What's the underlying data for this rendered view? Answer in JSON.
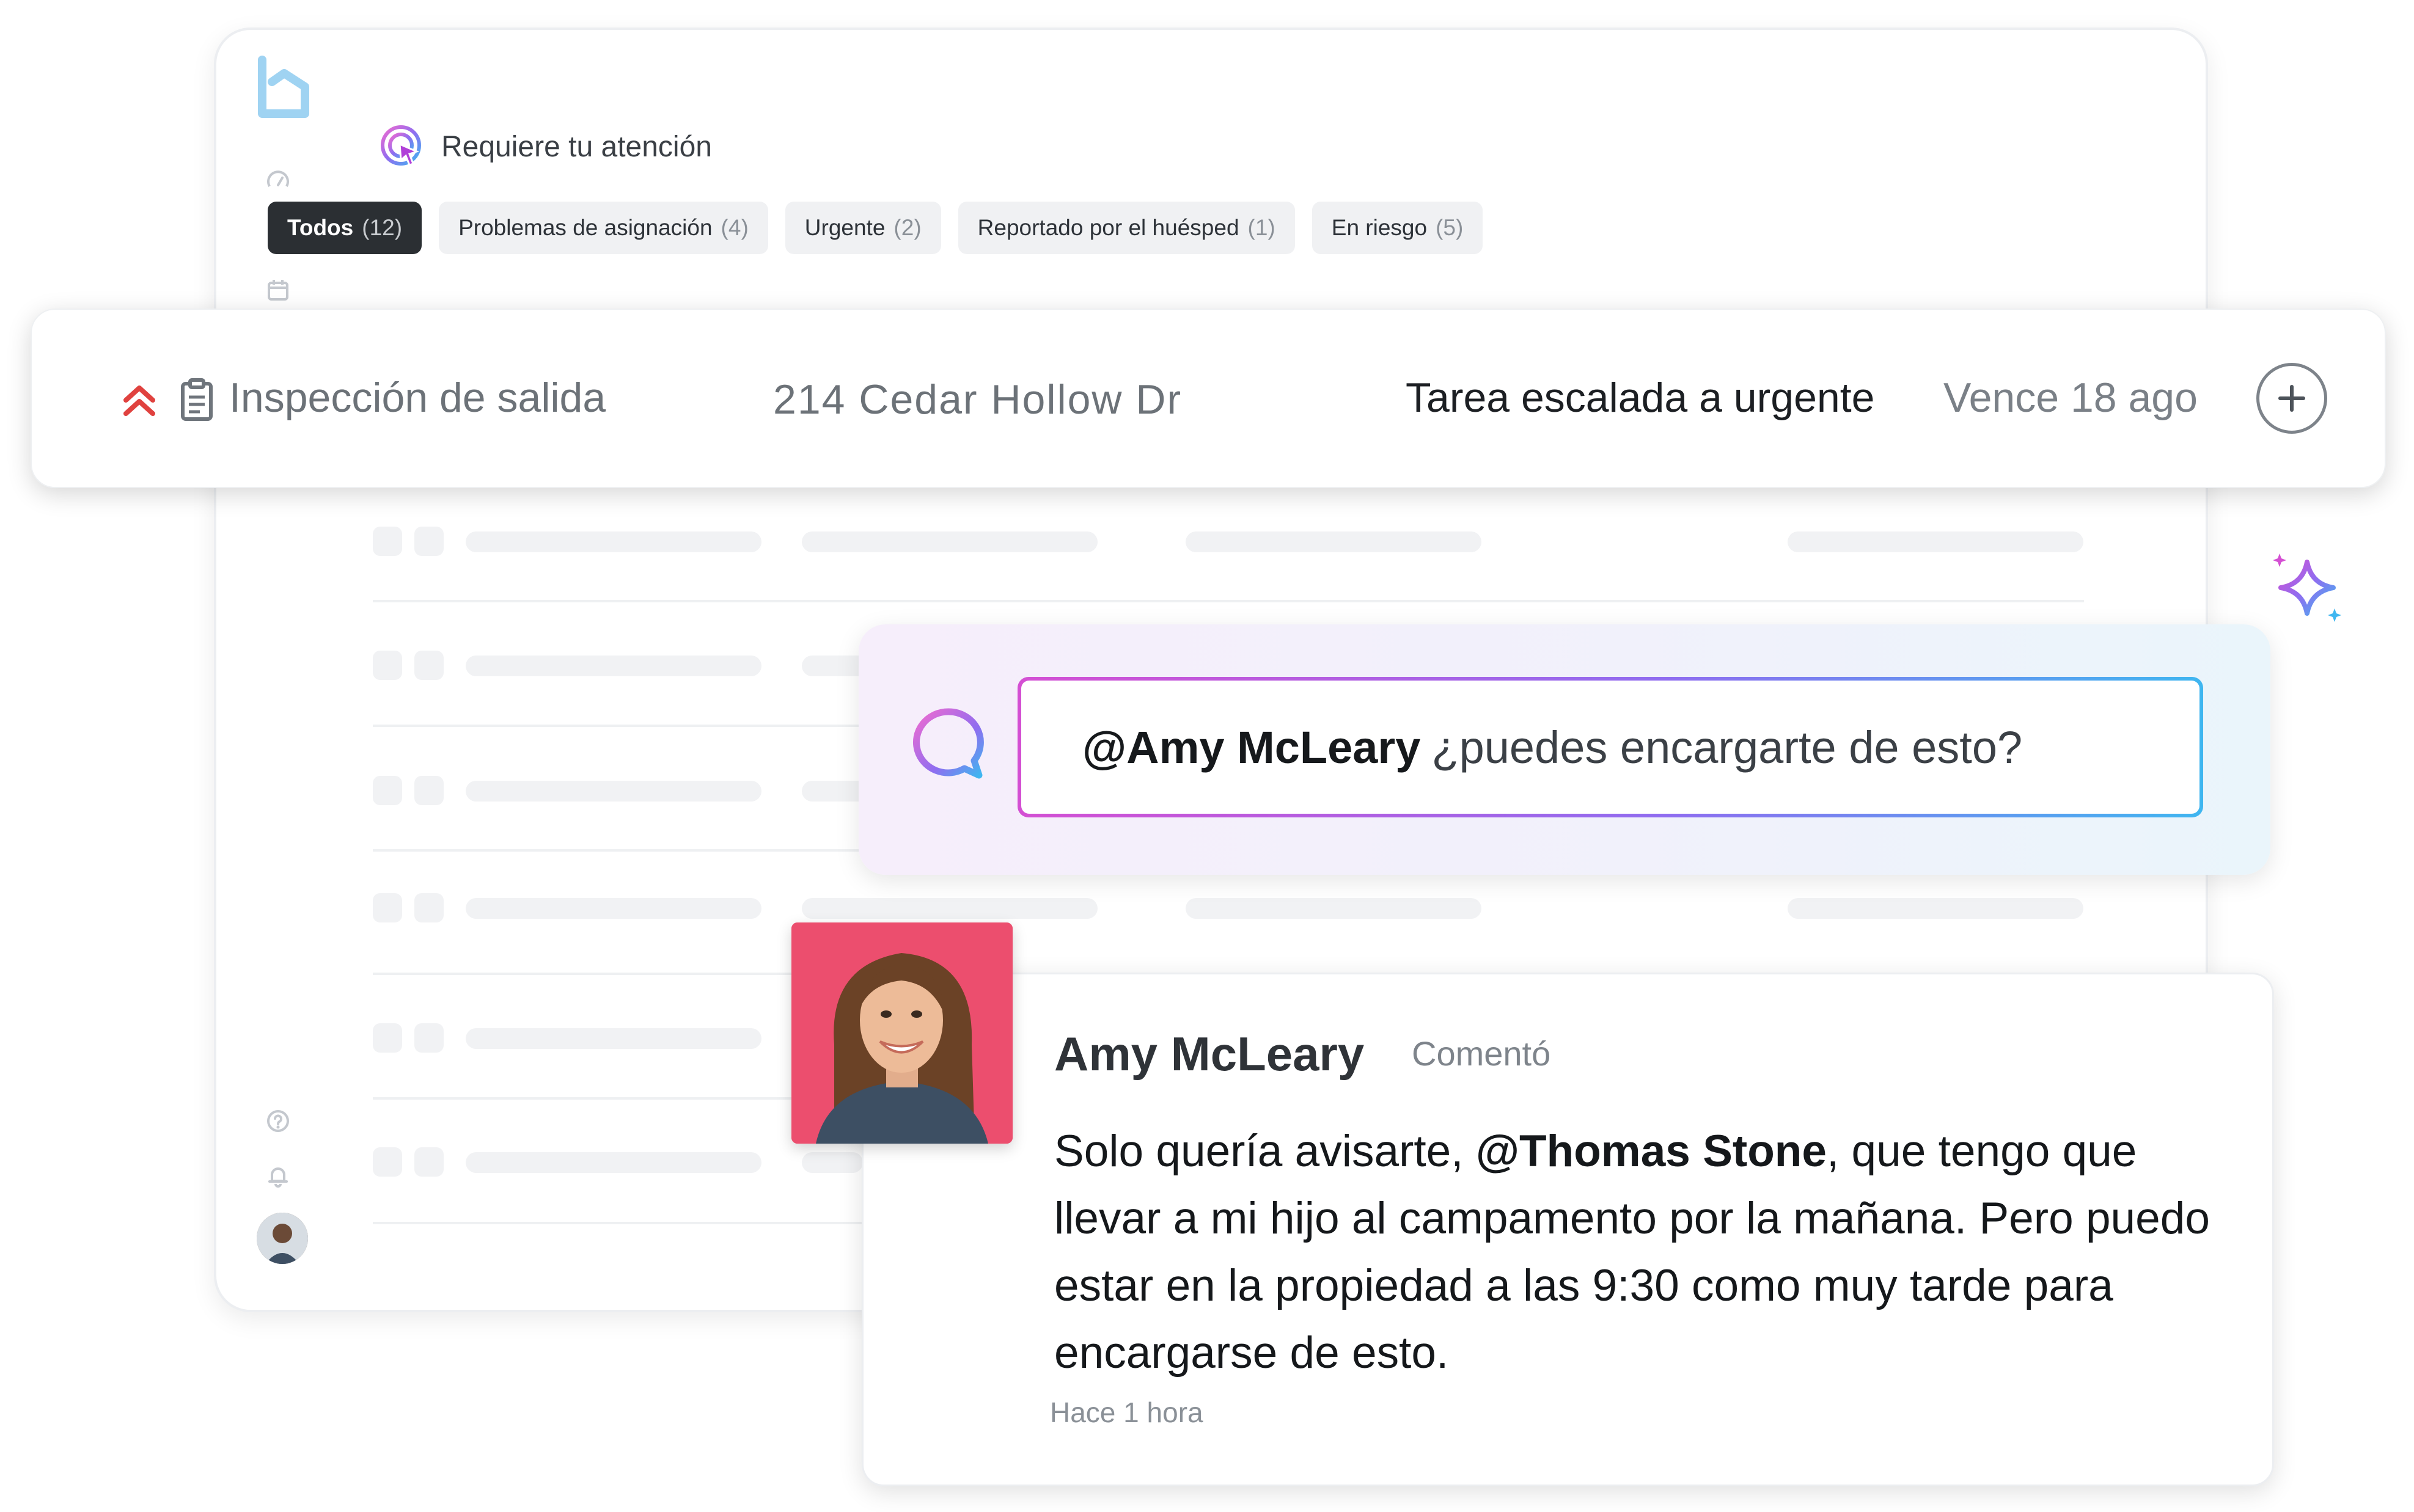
{
  "header": {
    "section_title": "Requiere tu atención"
  },
  "tabs": [
    {
      "label": "Todos",
      "count": "(12)",
      "active": true
    },
    {
      "label": "Problemas de asignación",
      "count": "(4)",
      "active": false
    },
    {
      "label": "Urgente",
      "count": "(2)",
      "active": false
    },
    {
      "label": "Reportado por el huésped",
      "count": "(1)",
      "active": false
    },
    {
      "label": "En riesgo",
      "count": "(5)",
      "active": false
    }
  ],
  "task": {
    "title": "Inspección de salida",
    "address": "214 Cedar Hollow Dr",
    "status": "Tarea escalada a urgente",
    "due": "Vence 18 ago"
  },
  "mention": {
    "mention_name": "@Amy McLeary",
    "text": "¿puedes encargarte de esto?"
  },
  "comment": {
    "author": "Amy McLeary",
    "action": "Comentó",
    "body_before": "Solo quería avisarte, ",
    "body_mention": "@Thomas Stone",
    "body_after": ", que tengo que llevar a mi hijo al campamento por la mañana. Pero puedo estar en la propiedad a las 9:30 como muy tarde para encargarse de esto.",
    "time": "Hace 1 hora"
  },
  "icons": {
    "logo": "brand-logo-icon",
    "attention": "attention-cursor-icon",
    "priority": "double-chevron-up-icon",
    "task_type": "clipboard-icon",
    "add": "plus-icon",
    "chat": "chat-bubble-icon",
    "sparkle": "sparkle-icon"
  },
  "colors": {
    "urgent": "#e0423f",
    "active_tab": "#2b2f33",
    "gradient_start": "#d44fd3",
    "gradient_end": "#3fb6f0",
    "photo_bg": "#ec4e6e"
  }
}
